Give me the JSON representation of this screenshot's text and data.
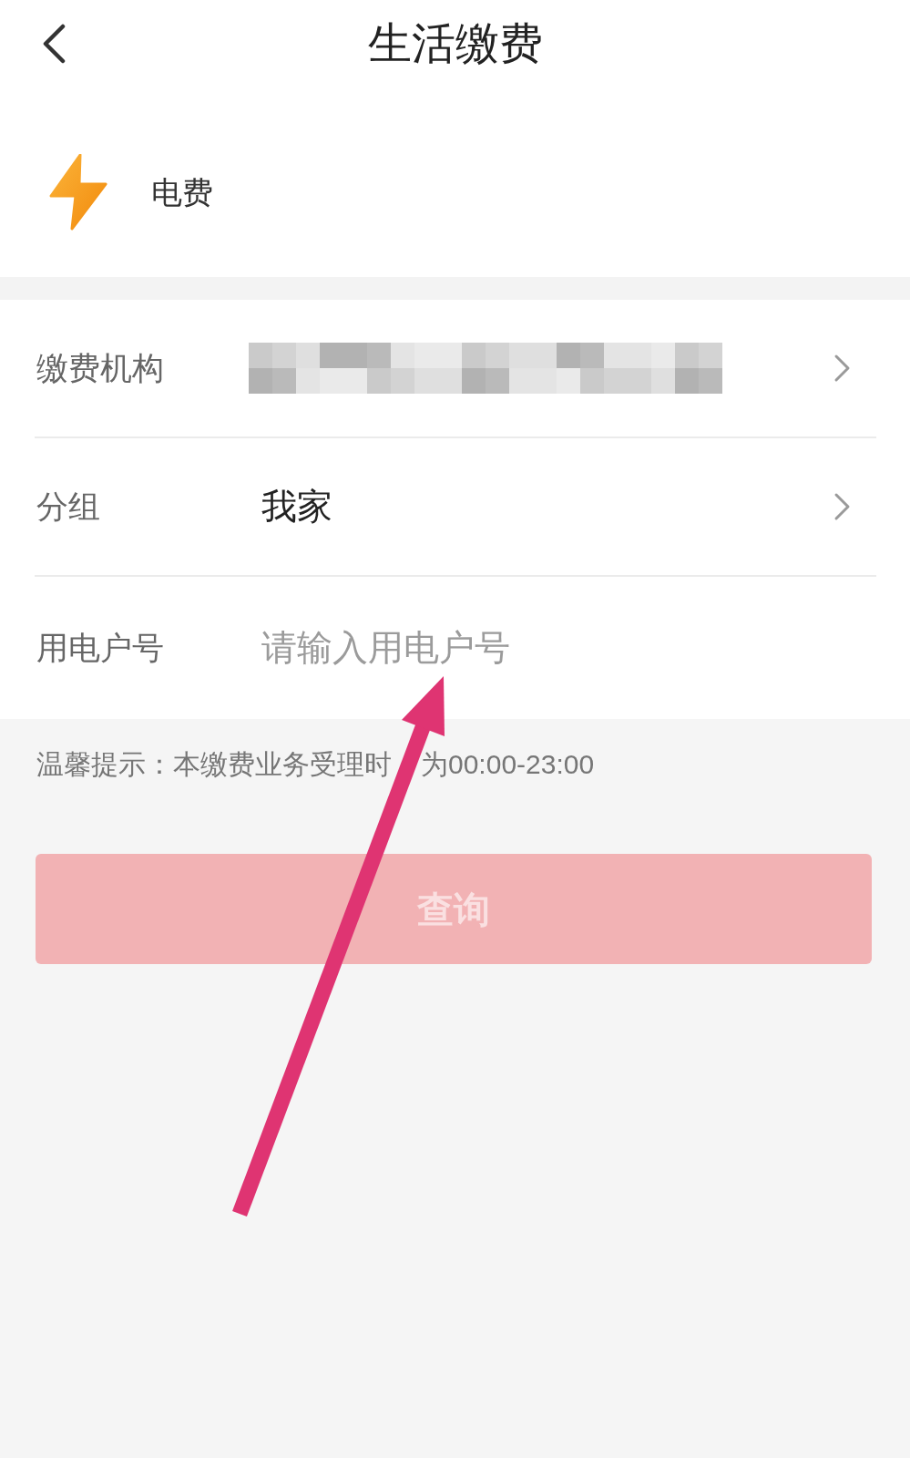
{
  "header": {
    "title": "生活缴费"
  },
  "service": {
    "name": "电费"
  },
  "form": {
    "rows": [
      {
        "kind": "select",
        "label": "缴费机构",
        "masked": true
      },
      {
        "kind": "select",
        "label": "分组",
        "value": "我家",
        "masked": false
      },
      {
        "kind": "input",
        "label": "用电户号",
        "placeholder": "请输入用电户号"
      }
    ]
  },
  "notice": [
    "温馨提示：本缴费业务受理时",
    "为00:00-23:00"
  ],
  "submit_button": {
    "label": "查询",
    "disabled": true
  },
  "annotations": [
    {
      "kind": "arrow"
    }
  ]
}
